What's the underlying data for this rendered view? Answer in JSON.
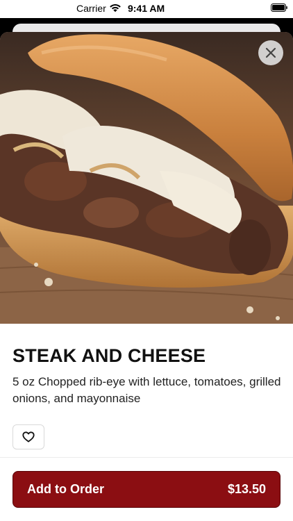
{
  "status_bar": {
    "carrier": "Carrier",
    "time": "9:41 AM"
  },
  "item": {
    "title": "STEAK AND CHEESE",
    "description": "5 oz Chopped rib-eye with lettuce, tomatoes, grilled onions, and mayonnaise",
    "image_alt": "Steak and cheese sandwich"
  },
  "actions": {
    "add_label": "Add to Order",
    "price": "$13.50"
  },
  "colors": {
    "primary": "#8b0e12",
    "text": "#111111"
  },
  "icons": {
    "close": "close-icon",
    "favorite": "heart-icon",
    "wifi": "wifi-icon",
    "battery": "battery-icon"
  }
}
